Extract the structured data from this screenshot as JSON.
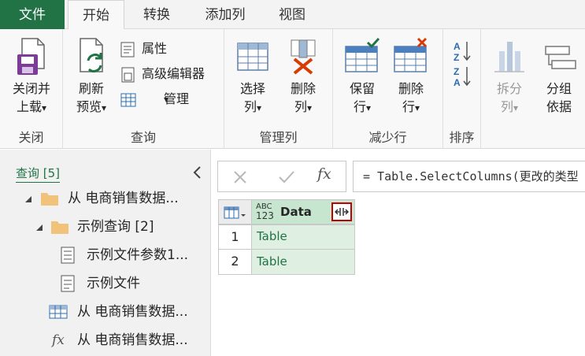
{
  "tabs": [
    "文件",
    "开始",
    "转换",
    "添加列",
    "视图"
  ],
  "groups": {
    "close": "关闭",
    "query": "查询",
    "manage_cols": "管理列",
    "reduce_rows": "减少行",
    "sort": "排序"
  },
  "buttons": {
    "close_load": [
      "关闭并",
      "上载"
    ],
    "refresh": [
      "刷新",
      "预览"
    ],
    "properties": "属性",
    "advanced_editor": "高级编辑器",
    "manage": "管理",
    "choose_cols": [
      "选择",
      "列"
    ],
    "remove_cols": [
      "删除",
      "列"
    ],
    "keep_rows": [
      "保留",
      "行"
    ],
    "remove_rows": [
      "删除",
      "行"
    ],
    "split_col": [
      "拆分",
      "列"
    ],
    "group_by": [
      "分组",
      "依据"
    ]
  },
  "caret": "▾",
  "queries": {
    "header": "查询 [5]",
    "items": [
      "从 电商销售数据...",
      "示例查询 [2]",
      "示例文件参数1...",
      "示例文件",
      "从 电商销售数据...",
      "从 电商销售数据..."
    ]
  },
  "formula": "= Table.SelectColumns(更改的类型",
  "fx": "fx",
  "table": {
    "type_top": "ABC",
    "type_bottom": "123",
    "column": "Data",
    "rows": [
      {
        "num": "1",
        "value": "Table"
      },
      {
        "num": "2",
        "value": "Table"
      }
    ]
  },
  "colors": {
    "accent": "#217346",
    "cell_bg": "#dff0e3",
    "header_bg": "#c6e6cf",
    "highlight_border": "#c00000"
  }
}
